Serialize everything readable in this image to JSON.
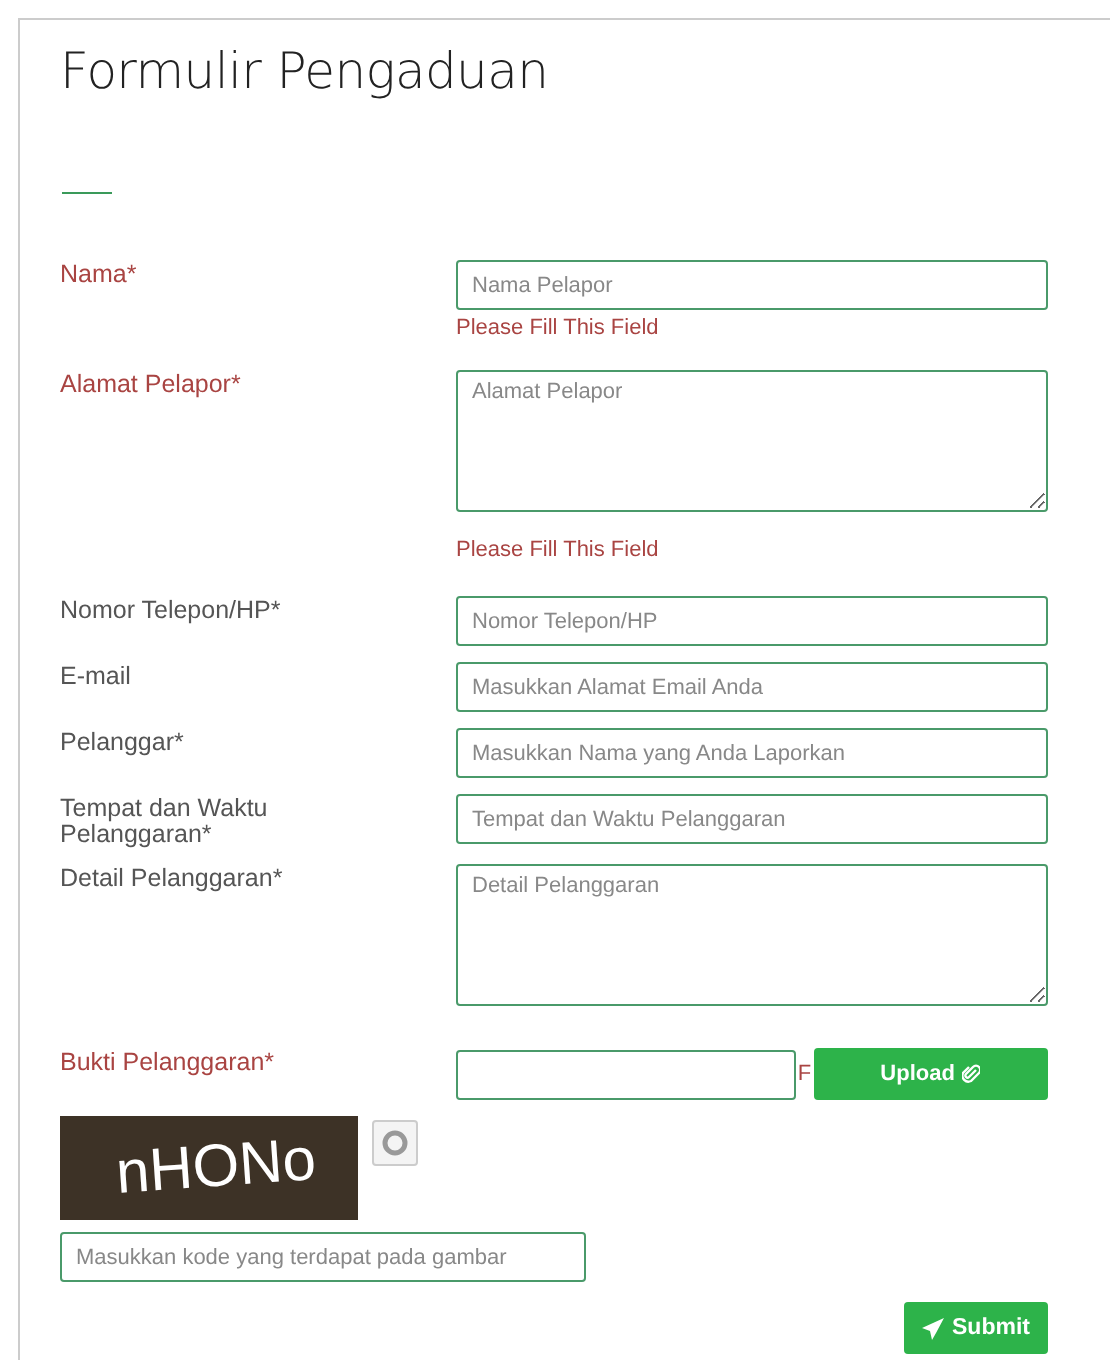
{
  "title": "Formulir Pengaduan",
  "fields": [
    {
      "kind": "input",
      "label": "Nama*",
      "placeholder": "Nama Pelapor",
      "error": "Please Fill This Field"
    },
    {
      "kind": "textarea",
      "label": "Alamat Pelapor*",
      "placeholder": "Alamat Pelapor",
      "error": "Please Fill This Field"
    },
    {
      "kind": "input",
      "label": "Nomor Telepon/HP*",
      "placeholder": "Nomor Telepon/HP"
    },
    {
      "kind": "input",
      "label": "E-mail",
      "placeholder": "Masukkan Alamat Email Anda"
    },
    {
      "kind": "input",
      "label": "Pelanggar*",
      "placeholder": "Masukkan Nama yang Anda Laporkan"
    },
    {
      "kind": "input",
      "label": "Tempat dan Waktu Pelanggaran*",
      "placeholder": "Tempat dan Waktu Pelanggaran"
    },
    {
      "kind": "textarea",
      "label": "Detail Pelanggaran*",
      "placeholder": "Detail Pelanggaran"
    },
    {
      "kind": "file",
      "label": "Bukti Pelanggaran*",
      "error": "F",
      "button": "Upload"
    }
  ],
  "captcha": {
    "code": "nHONo",
    "placeholder": "Masukkan kode yang terdapat pada gambar"
  },
  "submit": "Submit"
}
